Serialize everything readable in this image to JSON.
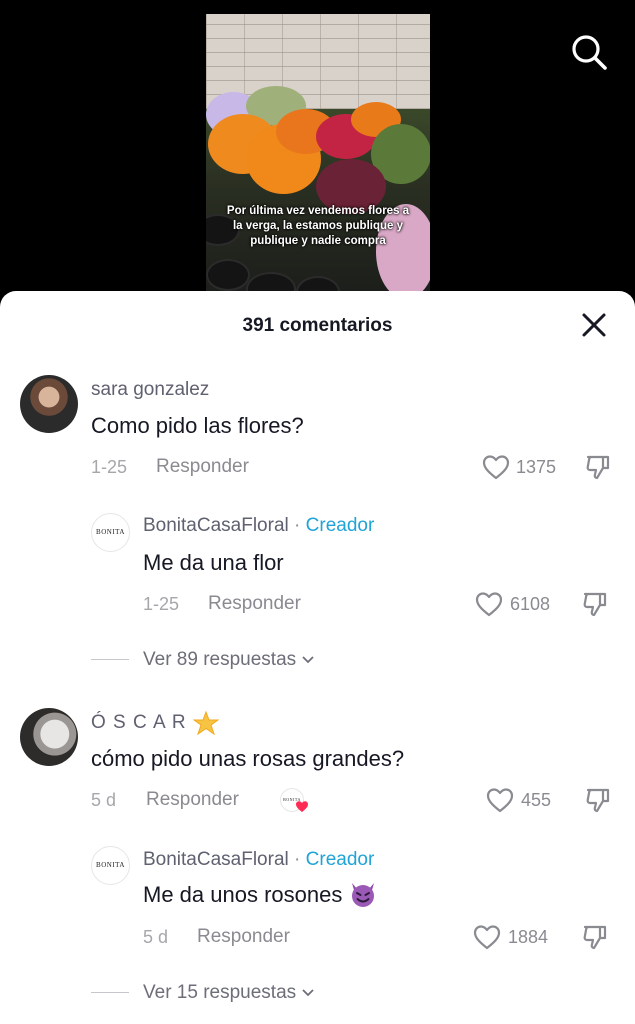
{
  "video": {
    "caption": "Por última vez vendemos flores a la verga, la estamos publique y publique y nadie compra"
  },
  "icons": {
    "search": "search-icon",
    "close": "close-icon",
    "like": "heart-outline-icon",
    "dislike": "thumbs-down-icon"
  },
  "sheet": {
    "title": "391 comentarios"
  },
  "comments": [
    {
      "username": "sara gonzalez",
      "text": "Como pido las flores?",
      "date": "1-25",
      "reply_label": "Responder",
      "likes": "1375",
      "creator_reply": {
        "username": "BonitaCasaFloral",
        "separator": "·",
        "badge": "Creador",
        "text": "Me da una flor",
        "date": "1-25",
        "reply_label": "Responder",
        "likes": "6108",
        "logo_text": "BONITA"
      },
      "more_replies": "Ver 89 respuestas"
    },
    {
      "username": "Ó S C A R",
      "text": "cómo pido unas rosas grandes?",
      "date": "5 d",
      "reply_label": "Responder",
      "likes": "455",
      "creator_liked_logo": "BONITA",
      "creator_reply": {
        "username": "BonitaCasaFloral",
        "separator": "·",
        "badge": "Creador",
        "text": "Me da unos rosones",
        "date": "5 d",
        "reply_label": "Responder",
        "likes": "1884",
        "logo_text": "BONITA"
      },
      "more_replies": "Ver 15 respuestas"
    }
  ],
  "colors": {
    "creator_badge": "#20a4d7",
    "text_primary": "#161823",
    "text_secondary": "#8a8b91"
  }
}
